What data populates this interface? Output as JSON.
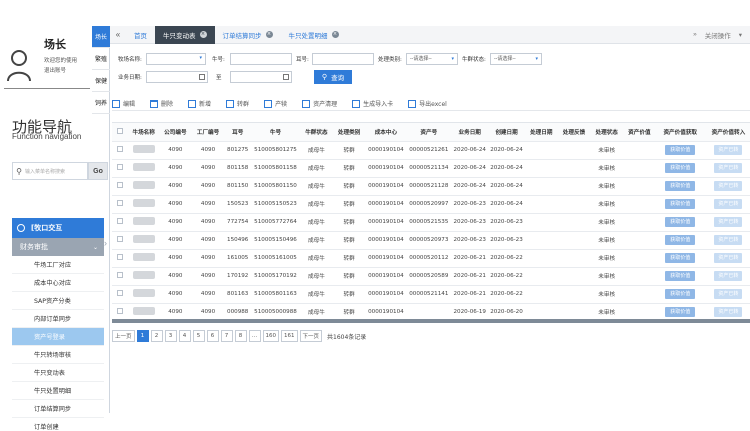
{
  "user": {
    "name": "场长",
    "line1": "欢迎您的使用",
    "line2": "退出账号"
  },
  "side_tabs": [
    "场长",
    "繁殖",
    "保健",
    "饲养"
  ],
  "nav": {
    "title": "功能导航",
    "subtitle": "Function navigation",
    "search_placeholder": "输入菜单名称搜索",
    "go": "Go",
    "group": "[牧口交互",
    "subgroup": "财务审批",
    "items": [
      "牛场工厂对应",
      "成本中心对应",
      "SAP资产分类",
      "内部订单同步",
      "资产号登录",
      "牛只转场审核",
      "牛只变动表",
      "牛只处置明细",
      "订单结算同步",
      "订单创建"
    ]
  },
  "tabs": {
    "home": "首页",
    "items": [
      "牛只变动表",
      "订单结算同步",
      "牛只处置明细"
    ],
    "close_ops": "关闭操作"
  },
  "filters": {
    "factory_label": "牧场名称:",
    "cow_no_label": "牛号:",
    "ear_no_label": "耳号:",
    "process_type_label": "处理类别:",
    "process_type_value": "--请选择--",
    "cow_status_label": "牛群状态:",
    "cow_status_value": "--请选择--",
    "biz_date_label": "业务日期:",
    "to_label": "至",
    "query_button": "查询"
  },
  "toolbar": [
    "编辑",
    "删除",
    "新增",
    "转群",
    "产犊",
    "资产清理",
    "生成导入卡",
    "导出excel"
  ],
  "grid": {
    "headers": [
      "",
      "牛场名称",
      "公司编号",
      "工厂编号",
      "耳号",
      "牛号",
      "牛群状态",
      "处理类别",
      "成本中心",
      "资产号",
      "业务日期",
      "创建日期",
      "处理日期",
      "处理反馈",
      "处理状态",
      "资产价值",
      "资产价值获取",
      "资产价值转入"
    ],
    "action_a": "获取价值",
    "action_b": "资产已转",
    "rows": [
      [
        "4090",
        "4090",
        "801275",
        "510005801275",
        "成母牛",
        "转群",
        "0000190104",
        "00000521261",
        "2020-06-24",
        "2020-06-24",
        "",
        "",
        "未审核",
        ""
      ],
      [
        "4090",
        "4090",
        "801158",
        "510005801158",
        "成母牛",
        "转群",
        "0000190104",
        "00000521134",
        "2020-06-24",
        "2020-06-24",
        "",
        "",
        "未审核",
        ""
      ],
      [
        "4090",
        "4090",
        "801150",
        "510005801150",
        "成母牛",
        "转群",
        "0000190104",
        "00000521128",
        "2020-06-24",
        "2020-06-24",
        "",
        "",
        "未审核",
        ""
      ],
      [
        "4090",
        "4090",
        "150523",
        "510005150523",
        "成母牛",
        "转群",
        "0000190104",
        "00000520997",
        "2020-06-23",
        "2020-06-24",
        "",
        "",
        "未审核",
        ""
      ],
      [
        "4090",
        "4090",
        "772754",
        "510005772764",
        "成母牛",
        "转群",
        "0000190104",
        "00000521535",
        "2020-06-23",
        "2020-06-23",
        "",
        "",
        "未审核",
        ""
      ],
      [
        "4090",
        "4090",
        "150496",
        "510005150496",
        "成母牛",
        "转群",
        "0000190104",
        "00000520973",
        "2020-06-23",
        "2020-06-23",
        "",
        "",
        "未审核",
        ""
      ],
      [
        "4090",
        "4090",
        "161005",
        "510005161005",
        "成母牛",
        "转群",
        "0000190104",
        "00000520112",
        "2020-06-21",
        "2020-06-22",
        "",
        "",
        "未审核",
        ""
      ],
      [
        "4090",
        "4090",
        "170192",
        "510005170192",
        "成母牛",
        "转群",
        "0000190104",
        "00000520589",
        "2020-06-21",
        "2020-06-22",
        "",
        "",
        "未审核",
        ""
      ],
      [
        "4090",
        "4090",
        "801163",
        "510005801163",
        "成母牛",
        "转群",
        "0000190104",
        "00000521141",
        "2020-06-21",
        "2020-06-22",
        "",
        "",
        "未审核",
        ""
      ],
      [
        "4090",
        "4090",
        "000988",
        "510005000988",
        "成母牛",
        "转群",
        "0000190104",
        "",
        "2020-06-19",
        "2020-06-20",
        "",
        "",
        "未审核",
        ""
      ]
    ]
  },
  "pager": {
    "prev": "上一页",
    "pages": [
      "1",
      "2",
      "3",
      "4",
      "5",
      "6",
      "7",
      "8",
      "...",
      "160",
      "161"
    ],
    "next": "下一页",
    "total": "共1604条记录"
  },
  "colors": {
    "accent": "#2f7bd8",
    "tab_active": "#3b4652",
    "menu_active": "#9cc8ef"
  }
}
